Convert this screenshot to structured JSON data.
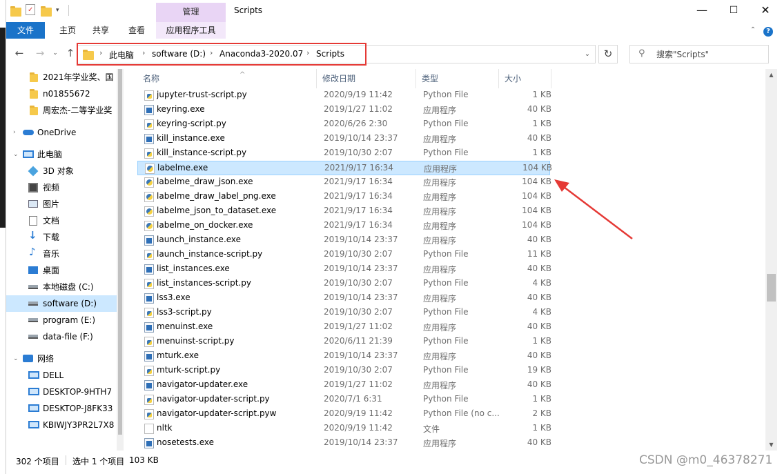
{
  "window": {
    "title": "Scripts",
    "context_tab_label": "管理",
    "minimize": "—",
    "maximize": "☐",
    "close": "✕"
  },
  "ribbon": {
    "tabs": [
      "文件",
      "主页",
      "共享",
      "查看",
      "应用程序工具"
    ],
    "collapse_icon": "chevron-up-icon",
    "help_icon": "help-icon"
  },
  "address": {
    "crumbs": [
      "此电脑",
      "software (D:)",
      "Anaconda3-2020.07",
      "Scripts"
    ],
    "search_placeholder": "搜索\"Scripts\"",
    "highlight_color": "#e53935"
  },
  "nav": {
    "items": [
      {
        "label": "2021年学业奖、国",
        "icon": "folder-icon"
      },
      {
        "label": "n01855672",
        "icon": "folder-icon"
      },
      {
        "label": "周宏杰-二等学业奖",
        "icon": "folder-icon"
      },
      {
        "label": "OneDrive",
        "icon": "onedrive-icon"
      },
      {
        "label": "此电脑",
        "icon": "pc-icon"
      },
      {
        "label": "3D 对象",
        "icon": "3d-objects-icon"
      },
      {
        "label": "视频",
        "icon": "video-icon"
      },
      {
        "label": "图片",
        "icon": "pictures-icon"
      },
      {
        "label": "文档",
        "icon": "documents-icon"
      },
      {
        "label": "下载",
        "icon": "downloads-icon"
      },
      {
        "label": "音乐",
        "icon": "music-icon"
      },
      {
        "label": "桌面",
        "icon": "desktop-icon"
      },
      {
        "label": "本地磁盘 (C:)",
        "icon": "drive-icon"
      },
      {
        "label": "software (D:)",
        "icon": "drive-icon",
        "selected": true
      },
      {
        "label": "program (E:)",
        "icon": "drive-icon"
      },
      {
        "label": "data-file (F:)",
        "icon": "drive-icon"
      },
      {
        "label": "网络",
        "icon": "network-icon"
      },
      {
        "label": "DELL",
        "icon": "computer-icon"
      },
      {
        "label": "DESKTOP-9HTH7",
        "icon": "computer-icon"
      },
      {
        "label": "DESKTOP-J8FK33",
        "icon": "computer-icon"
      },
      {
        "label": "KBIWJY3PR2L7X8",
        "icon": "computer-icon"
      }
    ]
  },
  "columns": {
    "name": "名称",
    "date": "修改日期",
    "type": "类型",
    "size": "大小"
  },
  "files": [
    {
      "name": "jupyter-trust-script.py",
      "date": "2020/9/19 11:42",
      "type": "Python File",
      "size": "1 KB",
      "icon": "py"
    },
    {
      "name": "keyring.exe",
      "date": "2019/1/27 11:02",
      "type": "应用程序",
      "size": "40 KB",
      "icon": "exe"
    },
    {
      "name": "keyring-script.py",
      "date": "2020/6/26 2:30",
      "type": "Python File",
      "size": "1 KB",
      "icon": "py"
    },
    {
      "name": "kill_instance.exe",
      "date": "2019/10/14 23:37",
      "type": "应用程序",
      "size": "40 KB",
      "icon": "exe"
    },
    {
      "name": "kill_instance-script.py",
      "date": "2019/10/30 2:07",
      "type": "Python File",
      "size": "1 KB",
      "icon": "py"
    },
    {
      "name": "labelme.exe",
      "date": "2021/9/17 16:34",
      "type": "应用程序",
      "size": "104 KB",
      "icon": "lbl",
      "selected": true
    },
    {
      "name": "labelme_draw_json.exe",
      "date": "2021/9/17 16:34",
      "type": "应用程序",
      "size": "104 KB",
      "icon": "lbl"
    },
    {
      "name": "labelme_draw_label_png.exe",
      "date": "2021/9/17 16:34",
      "type": "应用程序",
      "size": "104 KB",
      "icon": "lbl"
    },
    {
      "name": "labelme_json_to_dataset.exe",
      "date": "2021/9/17 16:34",
      "type": "应用程序",
      "size": "104 KB",
      "icon": "lbl"
    },
    {
      "name": "labelme_on_docker.exe",
      "date": "2021/9/17 16:34",
      "type": "应用程序",
      "size": "104 KB",
      "icon": "lbl"
    },
    {
      "name": "launch_instance.exe",
      "date": "2019/10/14 23:37",
      "type": "应用程序",
      "size": "40 KB",
      "icon": "exe"
    },
    {
      "name": "launch_instance-script.py",
      "date": "2019/10/30 2:07",
      "type": "Python File",
      "size": "11 KB",
      "icon": "py"
    },
    {
      "name": "list_instances.exe",
      "date": "2019/10/14 23:37",
      "type": "应用程序",
      "size": "40 KB",
      "icon": "exe"
    },
    {
      "name": "list_instances-script.py",
      "date": "2019/10/30 2:07",
      "type": "Python File",
      "size": "4 KB",
      "icon": "py"
    },
    {
      "name": "lss3.exe",
      "date": "2019/10/14 23:37",
      "type": "应用程序",
      "size": "40 KB",
      "icon": "exe"
    },
    {
      "name": "lss3-script.py",
      "date": "2019/10/30 2:07",
      "type": "Python File",
      "size": "4 KB",
      "icon": "py"
    },
    {
      "name": "menuinst.exe",
      "date": "2019/1/27 11:02",
      "type": "应用程序",
      "size": "40 KB",
      "icon": "exe"
    },
    {
      "name": "menuinst-script.py",
      "date": "2020/6/11 21:39",
      "type": "Python File",
      "size": "1 KB",
      "icon": "py"
    },
    {
      "name": "mturk.exe",
      "date": "2019/10/14 23:37",
      "type": "应用程序",
      "size": "40 KB",
      "icon": "exe"
    },
    {
      "name": "mturk-script.py",
      "date": "2019/10/30 2:07",
      "type": "Python File",
      "size": "19 KB",
      "icon": "py"
    },
    {
      "name": "navigator-updater.exe",
      "date": "2019/1/27 11:02",
      "type": "应用程序",
      "size": "40 KB",
      "icon": "exe"
    },
    {
      "name": "navigator-updater-script.py",
      "date": "2020/7/1 6:31",
      "type": "Python File",
      "size": "1 KB",
      "icon": "py"
    },
    {
      "name": "navigator-updater-script.pyw",
      "date": "2020/9/19 11:42",
      "type": "Python File (no c...",
      "size": "2 KB",
      "icon": "py"
    },
    {
      "name": "nltk",
      "date": "2020/9/19 11:42",
      "type": "文件",
      "size": "1 KB",
      "icon": "txt"
    },
    {
      "name": "nosetests.exe",
      "date": "2019/10/14 23:37",
      "type": "应用程序",
      "size": "40 KB",
      "icon": "exe"
    }
  ],
  "status": {
    "item_count": "302 个项目",
    "selected": "选中 1 个项目",
    "selected_size": "103 KB"
  },
  "watermark": "CSDN @m0_46378271",
  "colors": {
    "accent": "#1a73c9",
    "selection": "#cce8ff",
    "context_tab": "#e9d5f5",
    "annotation": "#e53935"
  }
}
